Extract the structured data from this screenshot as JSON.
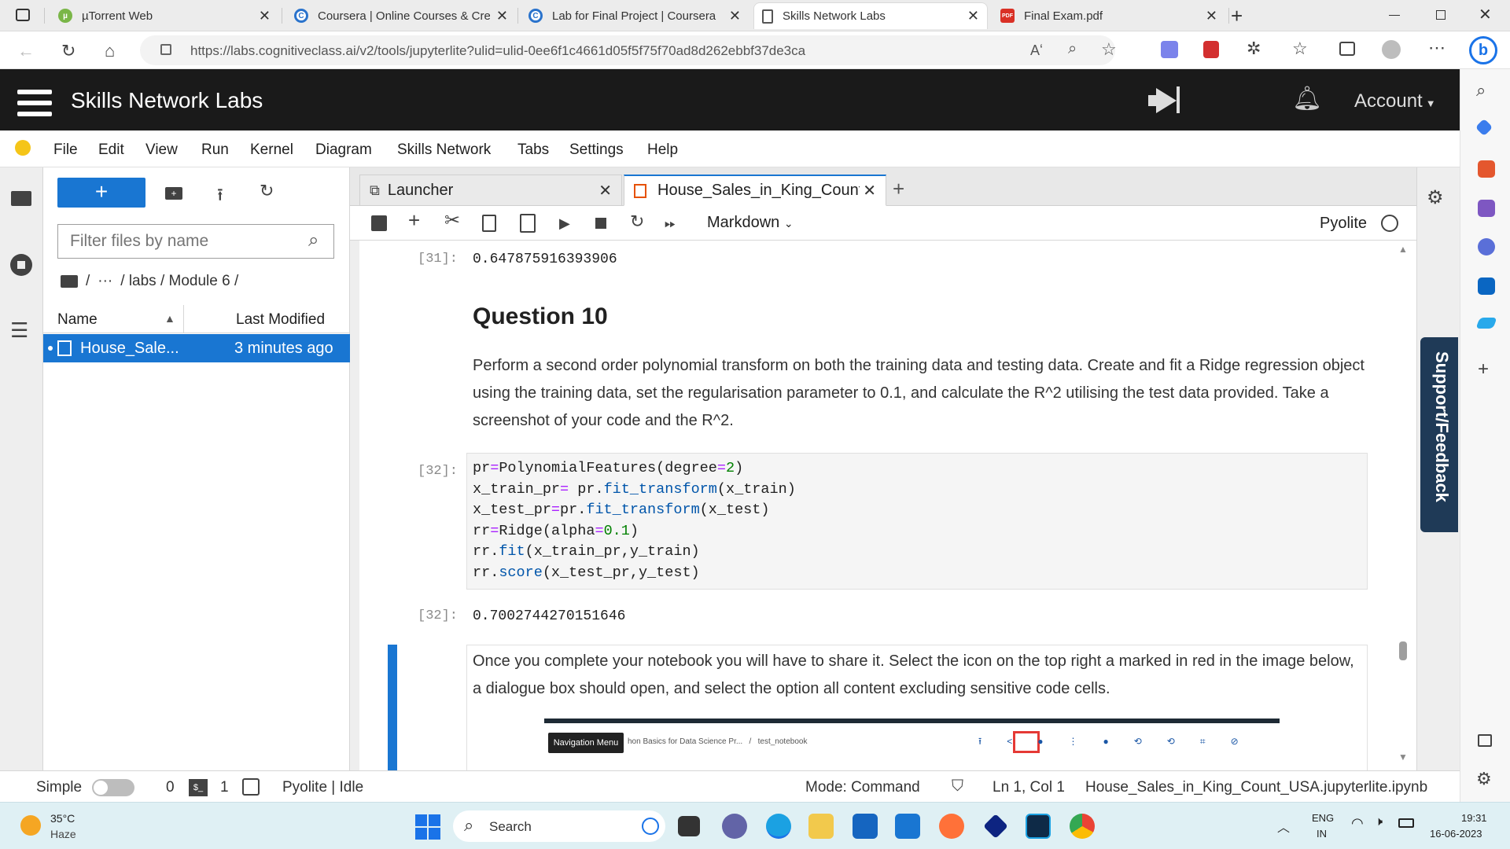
{
  "browser": {
    "tabs": [
      {
        "title": "µTorrent Web",
        "color": "#7ab648"
      },
      {
        "title": "Coursera | Online Courses & Cre",
        "color": "#2a73cc"
      },
      {
        "title": "Lab for Final Project | Coursera",
        "color": "#2a73cc"
      },
      {
        "title": "Skills Network Labs",
        "color": "#555555"
      },
      {
        "title": "Final Exam.pdf",
        "color": "#d93025"
      }
    ],
    "url_prefix": "https://labs.cognitiveclass.ai",
    "url_rest": "/v2/tools/jupyterlite?ulid=ulid-0ee6f1c4661d05f5f75f70ad8d262ebbf37de3ca",
    "reader_label": "Aʻ"
  },
  "app": {
    "brand": "Skills Network Labs",
    "account": "Account"
  },
  "menu": [
    "File",
    "Edit",
    "View",
    "Run",
    "Kernel",
    "Diagram",
    "Skills Network",
    "Tabs",
    "Settings",
    "Help"
  ],
  "filebrowser": {
    "new_label": "+",
    "filter_placeholder": "Filter files by name",
    "crumbs": [
      "/",
      "···",
      "/ labs / Module 6 /"
    ],
    "col_name": "Name",
    "col_modified": "Last Modified",
    "file_name": "House_Sale...",
    "file_modified": "3 minutes ago"
  },
  "notebook_tabs": {
    "launcher": "Launcher",
    "notebook": "House_Sales_in_King_Count_U"
  },
  "toolbar": {
    "cell_type": "Markdown",
    "kernel": "Pyolite"
  },
  "cells": {
    "out31_prompt": "[31]:",
    "out31": "0.647875916393906",
    "question_heading": "Question 10",
    "question_text": "Perform a second order polynomial transform on both the training data and testing data. Create and fit a Ridge regression object using the training data, set the regularisation parameter to 0.1, and calculate the R^2 utilising the test data provided. Take a screenshot of your code and the R^2.",
    "in32_prompt": "[32]:",
    "out32_prompt": "[32]:",
    "out32": "0.7002744270151646",
    "share_text": "Once you complete your notebook you will have to share it. Select the icon on the top right a marked in red in the image below, a dialogue box should open, and select the option all content excluding sensitive code cells.",
    "embedded_nav": "Navigation Menu",
    "embedded_path": "hon Basics for Data Science Pr...   /   test_notebook"
  },
  "support": "Support/Feedback",
  "status": {
    "mode_label": "Simple",
    "kernel_count": "0",
    "term_count": "1",
    "kernel_status": "Pyolite | Idle",
    "mode": "Mode: Command",
    "position": "Ln 1, Col 1",
    "filename": "House_Sales_in_King_Count_USA.jupyterlite.ipynb"
  },
  "taskbar": {
    "temp": "35°C",
    "weather": "Haze",
    "search": "Search",
    "lang1": "ENG",
    "lang2": "IN",
    "time": "19:31",
    "date": "16-06-2023"
  },
  "colors": {
    "accent": "#1976d2",
    "header_bg": "#1a1a1a",
    "highlight_red": "#e53935"
  }
}
